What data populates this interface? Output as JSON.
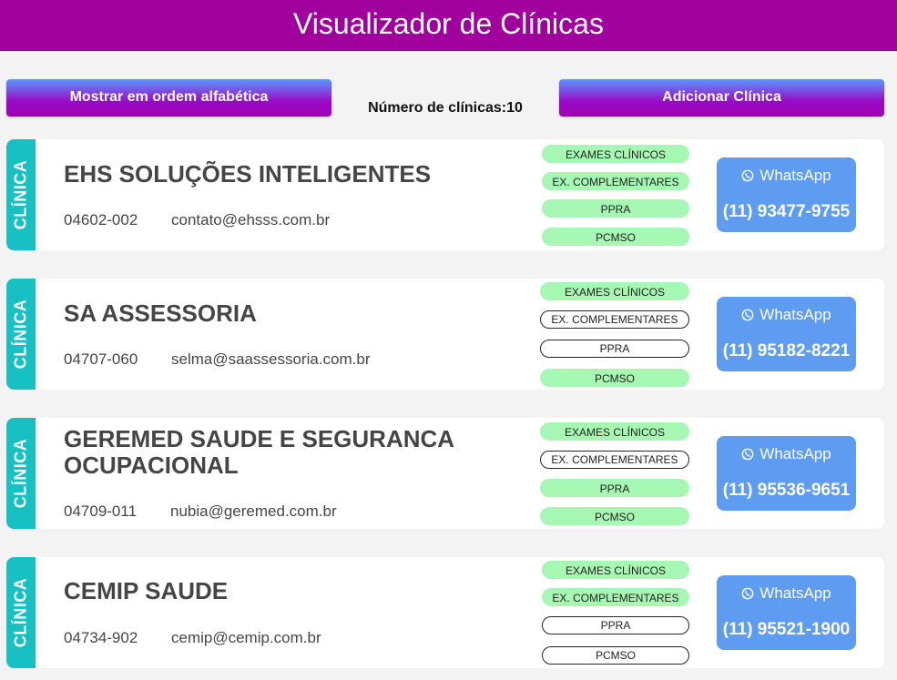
{
  "header": {
    "title": "Visualizador de Clínicas"
  },
  "toolbar": {
    "sort_label": "Mostrar em ordem alfabética",
    "count_label": "Número de clínicas:10",
    "add_label": "Adicionar Clínica"
  },
  "colors": {
    "header": "#a0009c",
    "tab": "#17c0c2",
    "service_on": "#a6f7b4",
    "whatsapp": "#5e9cf2"
  },
  "clinics": [
    {
      "tab": "CLÍNICA",
      "name": "EHS SOLUÇÕES INTELIGENTES",
      "cep": "04602-002",
      "email": "contato@ehsss.com.br",
      "services": [
        {
          "label": "EXAMES CLÍNICOS",
          "active": true
        },
        {
          "label": "EX. COMPLEMENTARES",
          "active": true
        },
        {
          "label": "PPRA",
          "active": true
        },
        {
          "label": "PCMSO",
          "active": true
        }
      ],
      "whatsapp_label": "WhatsApp",
      "phone": "(11) 93477-9755"
    },
    {
      "tab": "CLÍNICA",
      "name": "SA ASSESSORIA",
      "cep": "04707-060",
      "email": "selma@saassessoria.com.br",
      "services": [
        {
          "label": "EXAMES CLÍNICOS",
          "active": true
        },
        {
          "label": "EX. COMPLEMENTARES",
          "active": false
        },
        {
          "label": "PPRA",
          "active": false
        },
        {
          "label": "PCMSO",
          "active": true
        }
      ],
      "whatsapp_label": "WhatsApp",
      "phone": "(11) 95182-8221"
    },
    {
      "tab": "CLÍNICA",
      "name_line1": "GEREMED SAUDE E SEGURANCA",
      "name_line2": "OCUPACIONAL",
      "cep": "04709-011",
      "email": "nubia@geremed.com.br",
      "services": [
        {
          "label": "EXAMES CLÍNICOS",
          "active": true
        },
        {
          "label": "EX. COMPLEMENTARES",
          "active": false
        },
        {
          "label": "PPRA",
          "active": true
        },
        {
          "label": "PCMSO",
          "active": true
        }
      ],
      "whatsapp_label": "WhatsApp",
      "phone": "(11) 95536-9651"
    },
    {
      "tab": "CLÍNICA",
      "name": "CEMIP SAUDE",
      "cep": "04734-902",
      "email": "cemip@cemip.com.br",
      "services": [
        {
          "label": "EXAMES CLÍNICOS",
          "active": true
        },
        {
          "label": "EX. COMPLEMENTARES",
          "active": true
        },
        {
          "label": "PPRA",
          "active": false
        },
        {
          "label": "PCMSO",
          "active": false
        }
      ],
      "whatsapp_label": "WhatsApp",
      "phone": "(11) 95521-1900"
    }
  ]
}
